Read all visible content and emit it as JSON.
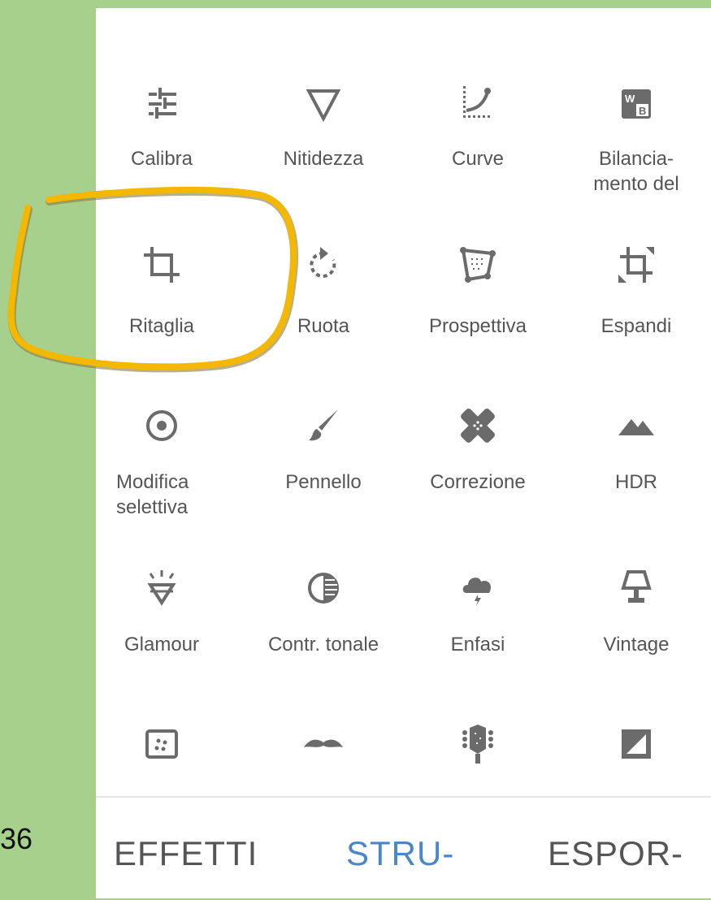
{
  "page_number": "36",
  "tools": [
    {
      "label": "Calibra",
      "icon": "tune-sliders-icon"
    },
    {
      "label": "Nitidezza",
      "icon": "triangle-down-icon"
    },
    {
      "label": "Curve",
      "icon": "curve-icon"
    },
    {
      "label": "Bilancia-\nmento del",
      "icon": "white-balance-icon"
    },
    {
      "label": "Ritaglia",
      "icon": "crop-icon"
    },
    {
      "label": "Ruota",
      "icon": "rotate-icon"
    },
    {
      "label": "Prospettiva",
      "icon": "perspective-icon"
    },
    {
      "label": "Espandi",
      "icon": "expand-icon"
    },
    {
      "label": "Modifica\nselettiva",
      "icon": "selective-target-icon"
    },
    {
      "label": "Pennello",
      "icon": "brush-icon"
    },
    {
      "label": "Correzione",
      "icon": "healing-bandage-icon"
    },
    {
      "label": "HDR",
      "icon": "mountains-icon"
    },
    {
      "label": "Glamour",
      "icon": "diamond-glow-icon"
    },
    {
      "label": "Contr. tonale",
      "icon": "tonal-contrast-icon"
    },
    {
      "label": "Enfasi",
      "icon": "storm-cloud-icon"
    },
    {
      "label": "Vintage",
      "icon": "lamp-icon"
    },
    {
      "label": "",
      "icon": "grainy-film-icon"
    },
    {
      "label": "",
      "icon": "moustache-icon"
    },
    {
      "label": "",
      "icon": "guitar-head-icon"
    },
    {
      "label": "",
      "icon": "frame-icon"
    }
  ],
  "tabs": [
    {
      "label": "EFFETTI",
      "active": false
    },
    {
      "label": "STRU-",
      "active": true
    },
    {
      "label": "ESPOR-",
      "active": false
    }
  ],
  "colors": {
    "background": "#a8d08d",
    "icon": "#6b6b6b",
    "active_tab": "#4a86c8",
    "highlight": "#f5b800"
  }
}
